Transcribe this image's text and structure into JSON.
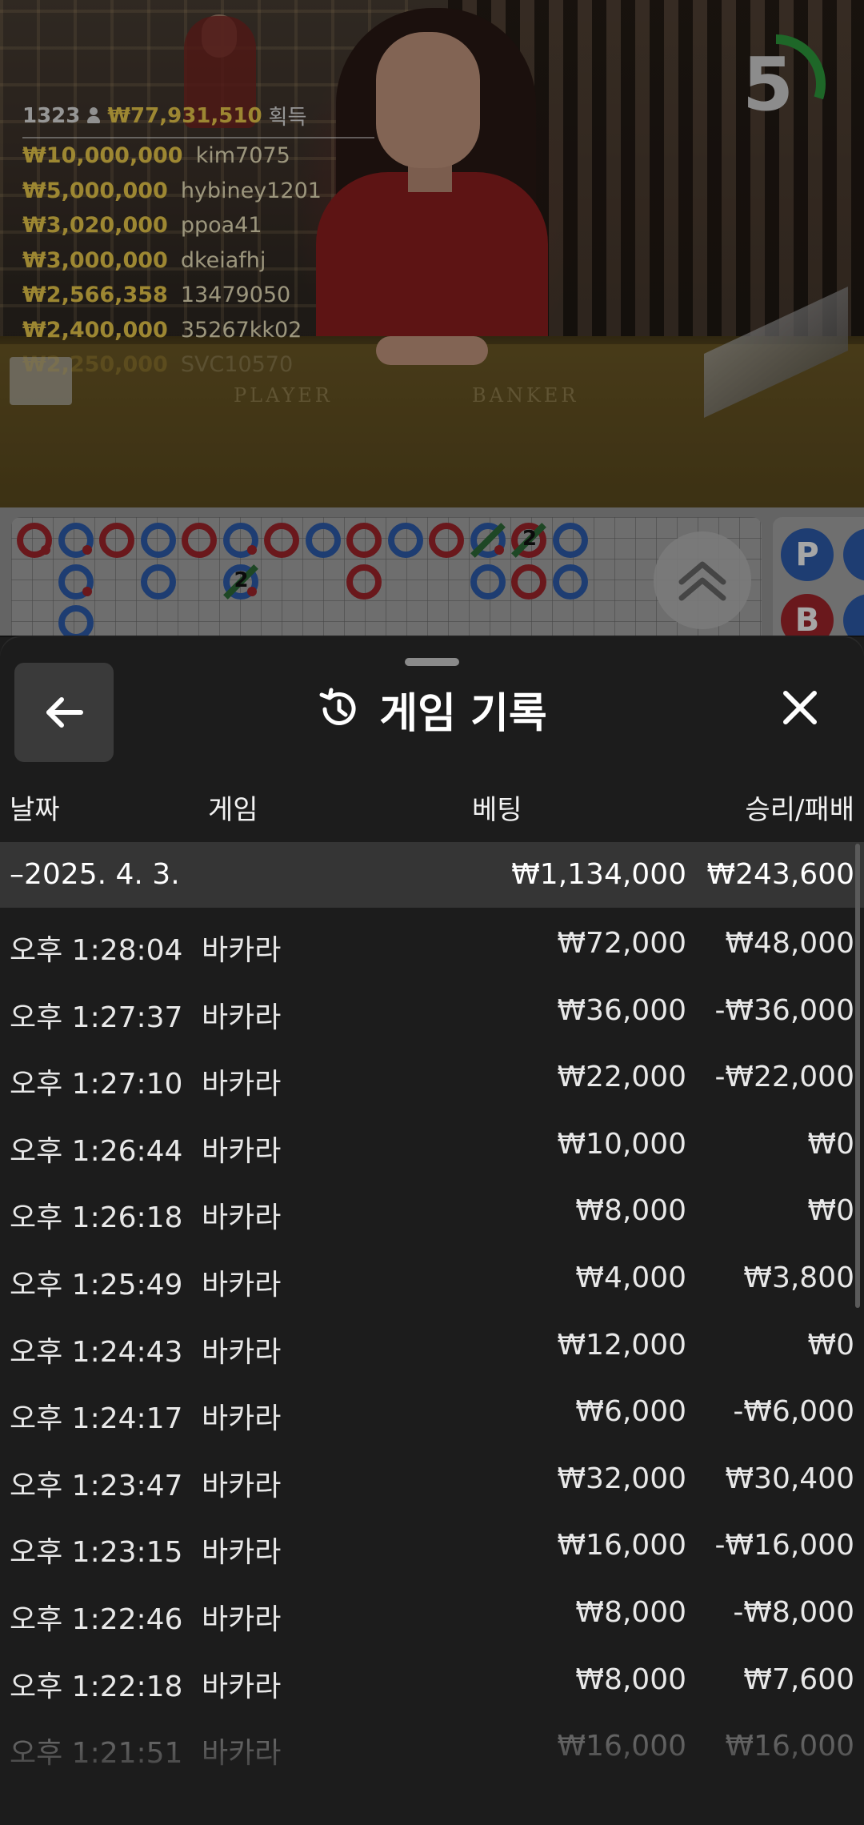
{
  "video": {
    "table_left": "PLAYER",
    "table_right": "BANKER",
    "countdown": "5",
    "winners_header": {
      "count": "1323",
      "total": "₩77,931,510",
      "label": "획득"
    },
    "winners": [
      {
        "amount": "₩10,000,000",
        "name": "kim7075"
      },
      {
        "amount": "₩5,000,000",
        "name": "hybiney1201"
      },
      {
        "amount": "₩3,020,000",
        "name": "ppoa41"
      },
      {
        "amount": "₩3,000,000",
        "name": "dkeiafhj"
      },
      {
        "amount": "₩2,566,358",
        "name": "13479050"
      },
      {
        "amount": "₩2,400,000",
        "name": "35267kk02"
      },
      {
        "amount": "₩2,250,000",
        "name": "SVC10570"
      }
    ],
    "countdown_progress": 0.3
  },
  "roadmap": {
    "tie_label": "2",
    "side_player": "P",
    "side_banker": "B"
  },
  "sheet": {
    "title": "게임 기록",
    "columns": {
      "date": "날짜",
      "game": "게임",
      "bet": "베팅",
      "result": "승리/패배"
    },
    "day": {
      "date": "–2025. 4. 3.",
      "bet": "₩1,134,000",
      "result": "₩243,600"
    },
    "rows": [
      {
        "time": "오후 1:28:04",
        "game": "바카라",
        "bet": "₩72,000",
        "result": "₩48,000"
      },
      {
        "time": "오후 1:27:37",
        "game": "바카라",
        "bet": "₩36,000",
        "result": "-₩36,000"
      },
      {
        "time": "오후 1:27:10",
        "game": "바카라",
        "bet": "₩22,000",
        "result": "-₩22,000"
      },
      {
        "time": "오후 1:26:44",
        "game": "바카라",
        "bet": "₩10,000",
        "result": "₩0"
      },
      {
        "time": "오후 1:26:18",
        "game": "바카라",
        "bet": "₩8,000",
        "result": "₩0"
      },
      {
        "time": "오후 1:25:49",
        "game": "바카라",
        "bet": "₩4,000",
        "result": "₩3,800"
      },
      {
        "time": "오후 1:24:43",
        "game": "바카라",
        "bet": "₩12,000",
        "result": "₩0"
      },
      {
        "time": "오후 1:24:17",
        "game": "바카라",
        "bet": "₩6,000",
        "result": "-₩6,000"
      },
      {
        "time": "오후 1:23:47",
        "game": "바카라",
        "bet": "₩32,000",
        "result": "₩30,400"
      },
      {
        "time": "오후 1:23:15",
        "game": "바카라",
        "bet": "₩16,000",
        "result": "-₩16,000"
      },
      {
        "time": "오후 1:22:46",
        "game": "바카라",
        "bet": "₩8,000",
        "result": "-₩8,000"
      },
      {
        "time": "오후 1:22:18",
        "game": "바카라",
        "bet": "₩8,000",
        "result": "₩7,600"
      },
      {
        "time": "오후 1:21:51",
        "game": "바카라",
        "bet": "₩16,000",
        "result": "₩16,000"
      }
    ]
  },
  "colors": {
    "accent_gold": "#f2cf4e",
    "banker_red": "#a3262c",
    "player_blue": "#2f5fb0",
    "timer_green": "#2e9e3e",
    "sheet_bg": "#1c1c1c"
  },
  "icons": {
    "back": "arrow-left-icon",
    "history": "history-clock-icon",
    "close": "close-icon",
    "expand": "chevron-up-double-icon"
  }
}
